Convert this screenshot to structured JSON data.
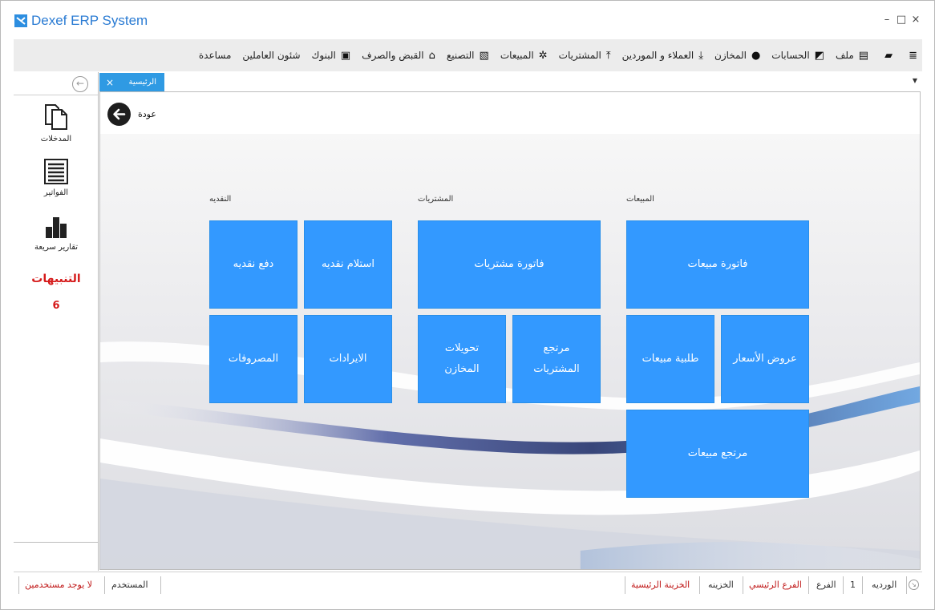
{
  "window": {
    "title": "Dexef ERP System",
    "controls": {
      "minimize": "–",
      "maximize": "□",
      "close": "×"
    }
  },
  "menu": [
    {
      "icon": "list-icon",
      "glyph": "≣",
      "label": ""
    },
    {
      "icon": "folder-icon",
      "glyph": "▰",
      "label": ""
    },
    {
      "icon": "file-icon",
      "glyph": "▤",
      "label": "ملف"
    },
    {
      "icon": "chart-icon",
      "glyph": "◩",
      "label": "الحسابات"
    },
    {
      "icon": "user-icon",
      "glyph": "●",
      "label": "المخازن"
    },
    {
      "icon": "download-icon",
      "glyph": "⤓",
      "label": "العملاء و الموردين"
    },
    {
      "icon": "upload-icon",
      "glyph": "⤒",
      "label": "المشتريات"
    },
    {
      "icon": "gear-icon",
      "glyph": "✲",
      "label": "المبيعات"
    },
    {
      "icon": "money-icon",
      "glyph": "▧",
      "label": "التصنيع"
    },
    {
      "icon": "bank-icon",
      "glyph": "⌂",
      "label": "القبض والصرف"
    },
    {
      "icon": "image-icon",
      "glyph": "▣",
      "label": "البنوك"
    },
    {
      "icon": "",
      "glyph": "",
      "label": "شئون العاملين"
    },
    {
      "icon": "",
      "glyph": "",
      "label": "مساعدة"
    }
  ],
  "sidebar": {
    "items": [
      {
        "label": "المدخلات"
      },
      {
        "label": "الفواتير"
      },
      {
        "label": "تقارير سريعة"
      }
    ],
    "alerts_title": "التنبيهات",
    "alerts_count": "6"
  },
  "tabs": [
    {
      "label": "الرئيسية",
      "close": "×"
    }
  ],
  "content": {
    "back_label": "عودة",
    "groups": [
      {
        "title": "المبيعات"
      },
      {
        "title": "المشتريات"
      },
      {
        "title": "النقديه"
      }
    ],
    "tiles": {
      "sales_invoice": "فاتورة مبيعات",
      "price_offers": "عروض الأسعار",
      "sales_order": "طلبية مبيعات",
      "sales_return": "مرتجع مبيعات",
      "purchase_invoice": "فاتورة مشتريات",
      "purchase_return": "مرتجع المشتريات",
      "store_transfers": "تحويلات المخازن",
      "cash_receipt": "استلام نقديه",
      "cash_payment": "دفع نقديه",
      "revenues": "الايرادات",
      "expenses": "المصروفات"
    }
  },
  "status": {
    "shift_label": "الورديه",
    "shift_value": "1",
    "branch_label": "الفرع",
    "branch_value": "الفرع الرئيسي",
    "treasury_label": "الخزينه",
    "treasury_value": "الخزينة الرئيسية",
    "user_label": "المستخدم",
    "user_value": "لا يوجد مستخدمين"
  }
}
